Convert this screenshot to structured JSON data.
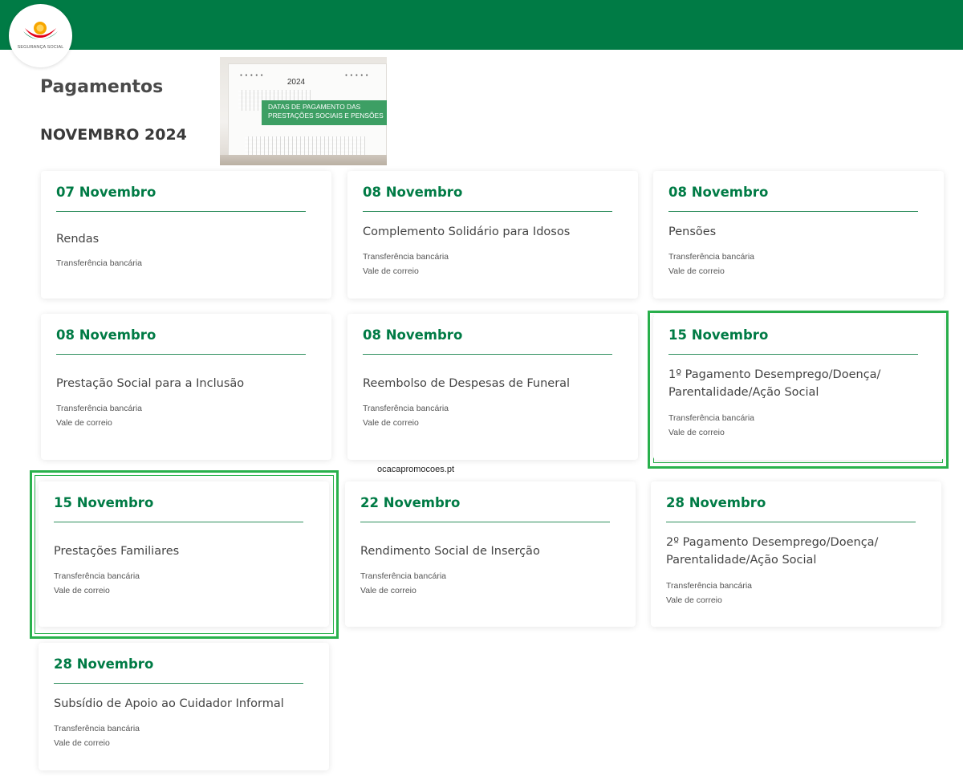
{
  "header": {
    "logo_icon": "seguranca-social-logo-icon",
    "logo_text": "SEGURANÇA SOCIAL",
    "color": "#007b45"
  },
  "page": {
    "title": "Pagamentos",
    "month": "NOVEMBRO 2024"
  },
  "banner": {
    "year": "2024",
    "line1": "DATAS DE PAGAMENTO DAS",
    "line2": "PRESTAÇÕES SOCIAIS E PENSÕES",
    "rings": "● ● ● ● ●"
  },
  "watermark": "ocacapromocoes.pt",
  "cards": [
    {
      "date": "07 Novembro",
      "name": "Rendas",
      "methods": [
        "Transferência bancária"
      ]
    },
    {
      "date": "08 Novembro",
      "name": "Complemento Solidário para Idosos",
      "methods": [
        "Transferência bancária",
        "Vale de correio"
      ]
    },
    {
      "date": "08 Novembro",
      "name": "Pensões",
      "methods": [
        "Transferência bancária",
        "Vale de correio"
      ]
    },
    {
      "date": "08 Novembro",
      "name": "Prestação Social para a Inclusão",
      "methods": [
        "Transferência bancária",
        "Vale de correio"
      ]
    },
    {
      "date": "08 Novembro",
      "name": "Reembolso de Despesas de Funeral",
      "methods": [
        "Transferência bancária",
        "Vale de correio"
      ]
    },
    {
      "date": "15 Novembro",
      "name": "1º Pagamento Desemprego/Doença/ Parentalidade/Ação Social",
      "methods": [
        "Transferência bancária",
        "Vale de correio"
      ]
    },
    {
      "date": "15 Novembro",
      "name": "Prestações Familiares",
      "methods": [
        "Transferência bancária",
        "Vale de correio"
      ]
    },
    {
      "date": "22 Novembro",
      "name": "Rendimento Social de Inserção",
      "methods": [
        "Transferência bancária",
        "Vale de correio"
      ]
    },
    {
      "date": "28 Novembro",
      "name": "2º Pagamento Desemprego/Doença/ Parentalidade/Ação Social",
      "methods": [
        "Transferência bancária",
        "Vale de correio"
      ]
    },
    {
      "date": "28 Novembro",
      "name": "Subsídio de Apoio ao Cuidador Informal",
      "methods": [
        "Transferência bancária",
        "Vale de correio"
      ]
    }
  ]
}
